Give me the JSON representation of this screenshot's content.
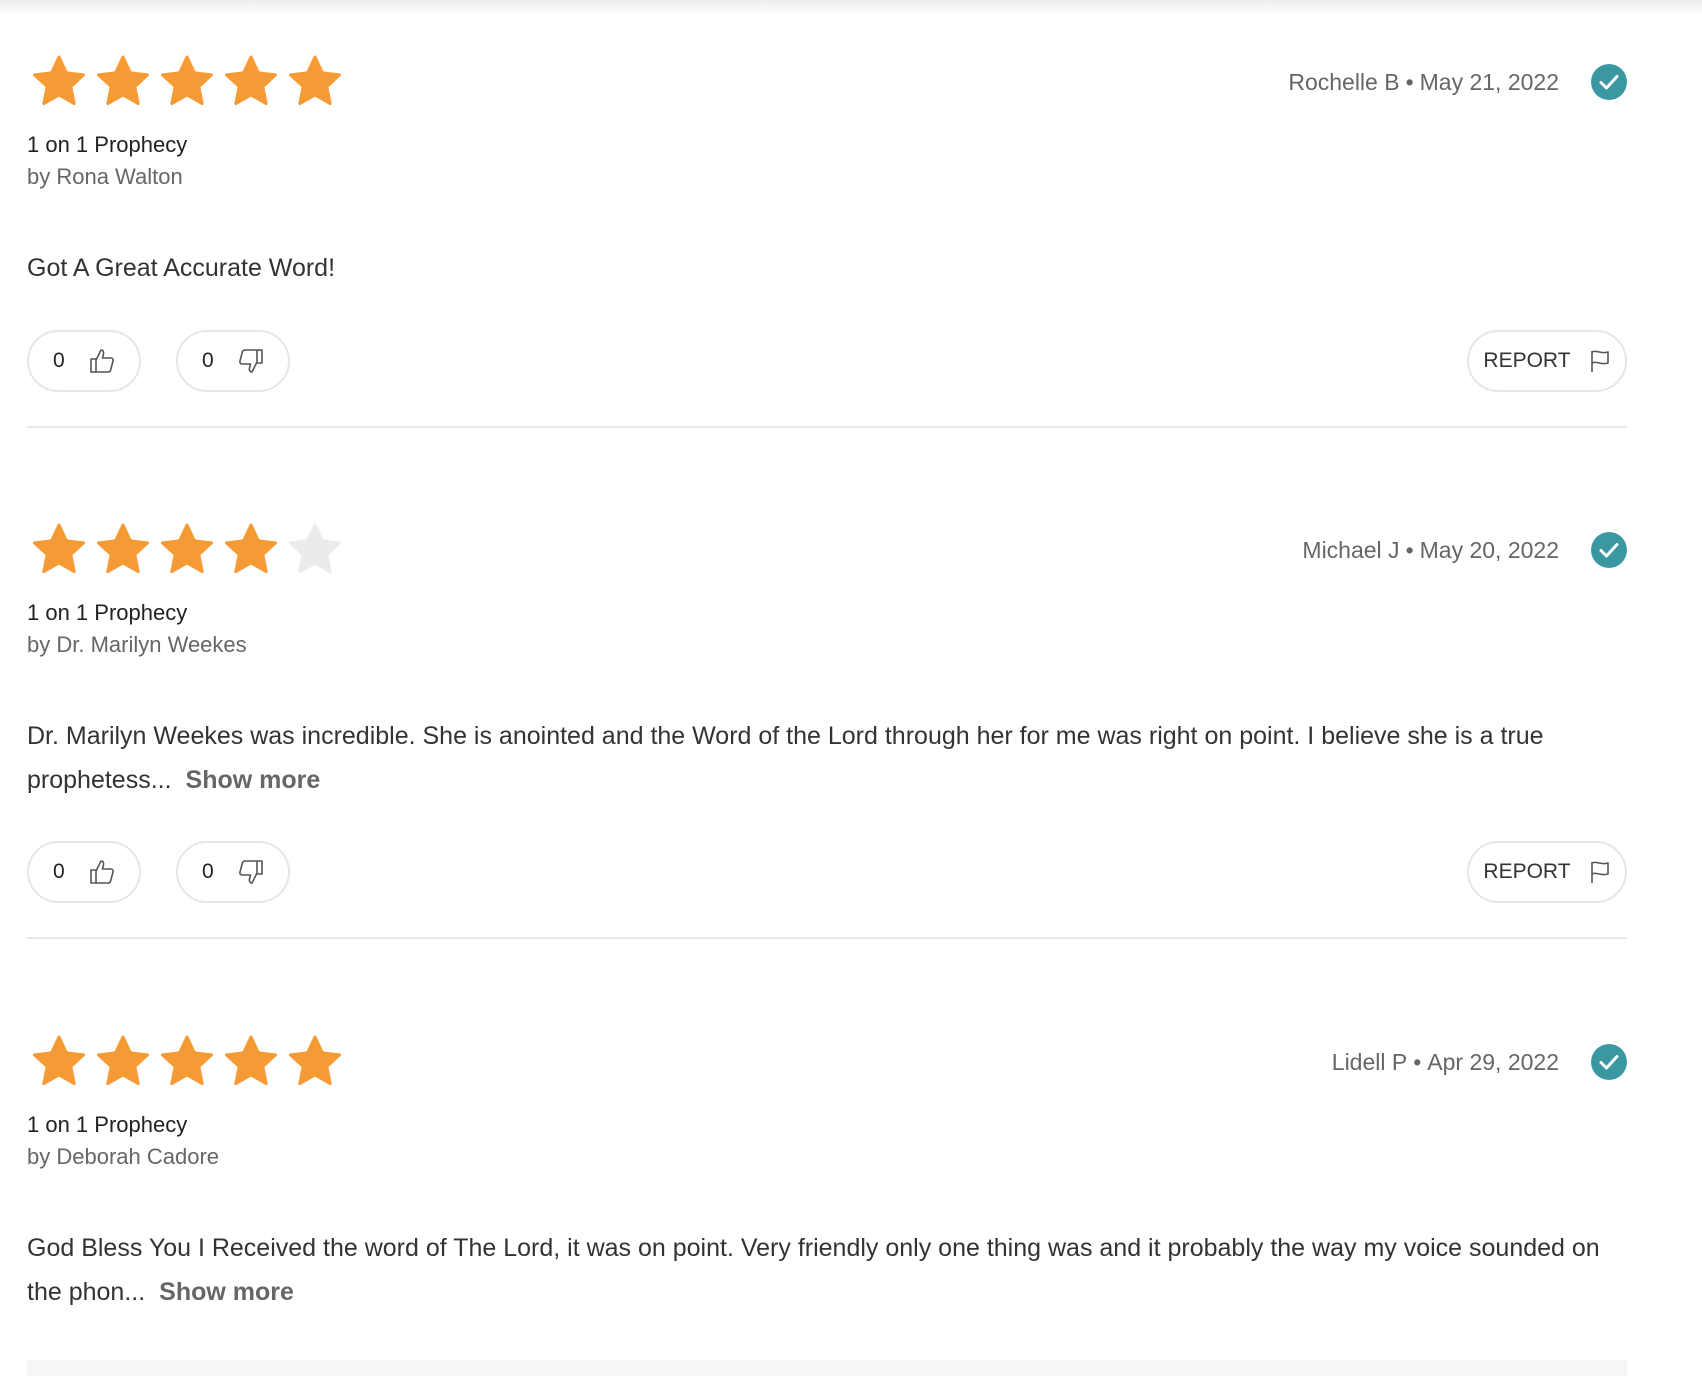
{
  "colors": {
    "star_filled": "#f59b35",
    "star_empty": "#ebebeb",
    "verified": "#3b98a3",
    "border": "#e6e6e6"
  },
  "reviews": [
    {
      "rating": 5,
      "author": "Rochelle B",
      "separator": "•",
      "date": "May 21, 2022",
      "verified_icon": "check-circle-icon",
      "service": "1 on 1 Prophecy",
      "advisor": "by Rona Walton",
      "text": "Got A Great Accurate Word!",
      "show_more": "",
      "helpful_count": "0",
      "unhelpful_count": "0",
      "report_label": "REPORT"
    },
    {
      "rating": 4,
      "author": "Michael J",
      "separator": "•",
      "date": "May 20, 2022",
      "verified_icon": "check-circle-icon",
      "service": "1 on 1 Prophecy",
      "advisor": "by Dr. Marilyn Weekes",
      "text": "Dr. Marilyn Weekes was incredible. She is anointed and the Word of the Lord through her for me was right on point. I believe she is a true prophetess...",
      "show_more": "Show more",
      "helpful_count": "0",
      "unhelpful_count": "0",
      "report_label": "REPORT"
    },
    {
      "rating": 5,
      "author": "Lidell P",
      "separator": "•",
      "date": "Apr 29, 2022",
      "verified_icon": "check-circle-icon",
      "service": "1 on 1 Prophecy",
      "advisor": "by Deborah Cadore",
      "text": "God Bless You I Received the word of The Lord, it was on point. Very friendly only one thing was and it probably the way my voice sounded on the phon...",
      "show_more": "Show more",
      "helpful_count": "",
      "unhelpful_count": "",
      "report_label": ""
    }
  ]
}
